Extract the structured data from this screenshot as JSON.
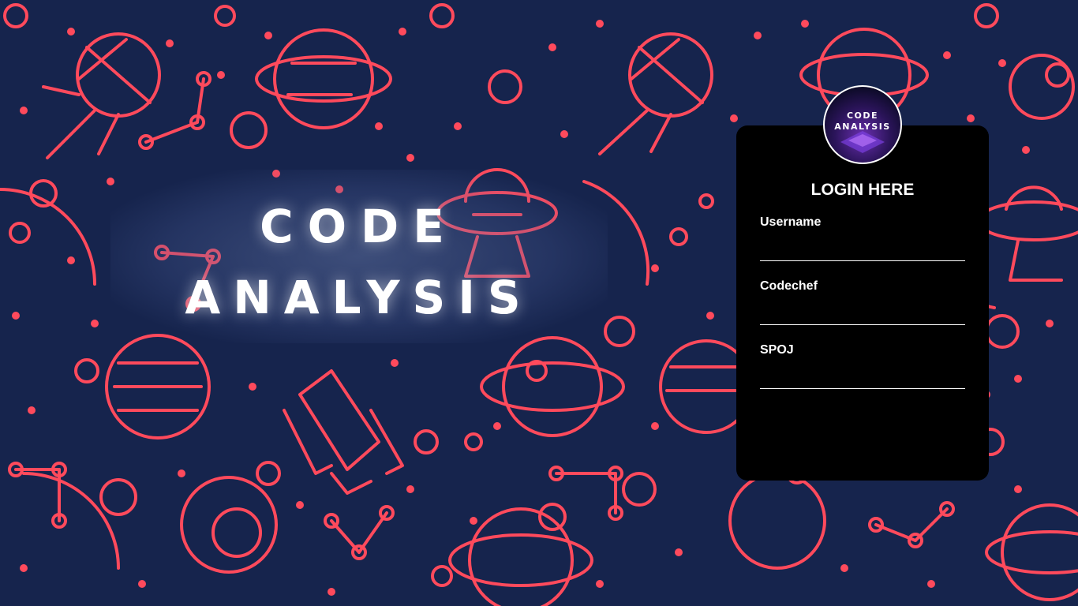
{
  "brand": {
    "line1": "CODE",
    "line2": "ANALYSIS"
  },
  "logo": {
    "line1": "CODE",
    "line2": "ANALYSIS"
  },
  "login": {
    "title": "LOGIN HERE",
    "fields": [
      {
        "label": "Username",
        "value": ""
      },
      {
        "label": "Codechef",
        "value": ""
      },
      {
        "label": "SPOJ",
        "value": ""
      }
    ]
  },
  "colors": {
    "background": "#16244d",
    "pattern": "#ff4a5c",
    "card": "#000000",
    "text": "#ffffff"
  },
  "icons": [
    "planet-icon",
    "satellite-icon",
    "ufo-icon",
    "rocket-icon",
    "constellation-icon",
    "star-dot-icon"
  ]
}
